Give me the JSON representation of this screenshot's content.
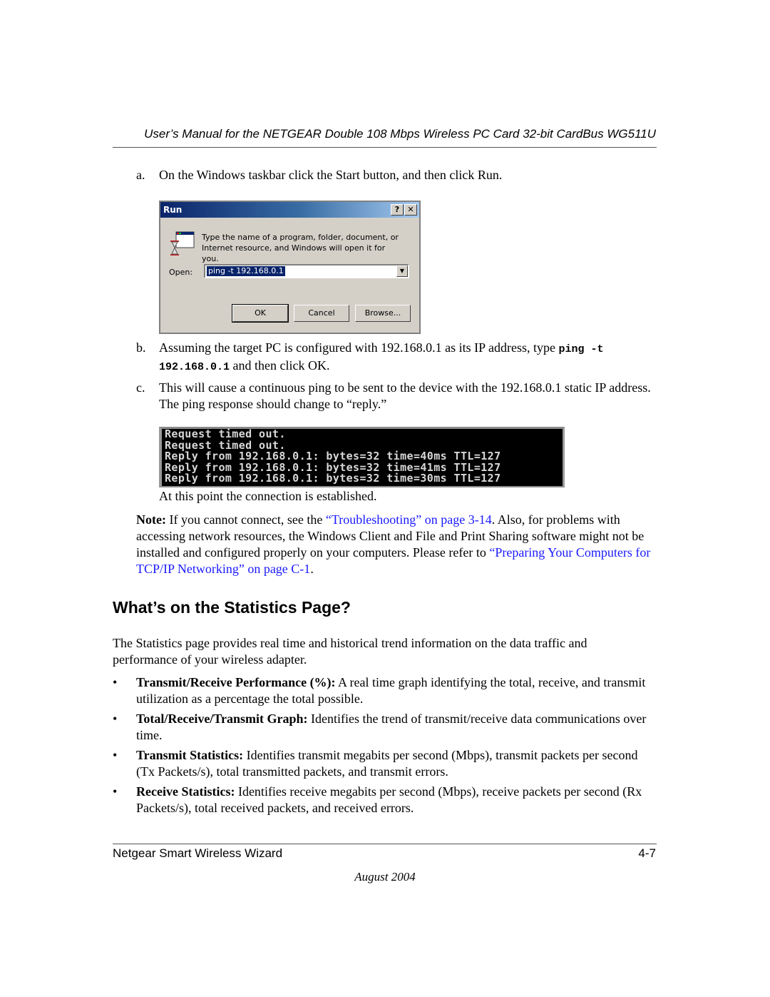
{
  "header": {
    "title": "User’s Manual for the NETGEAR Double 108 Mbps Wireless PC Card 32-bit CardBus WG511U"
  },
  "steps": [
    {
      "marker": "a.",
      "text": "On the Windows taskbar click the Start button, and then click Run."
    },
    {
      "marker": "b.",
      "text_before": "Assuming the target PC is configured with 192.168.0.1 as its IP address, type ",
      "code_1": "ping -t",
      "code_2": "192.168.0.1",
      "text_after": " and then click OK."
    },
    {
      "marker": "c.",
      "text": "This will cause a continuous ping to be sent to the device with the 192.168.0.1 static IP address. The ping response should change to “reply.”"
    }
  ],
  "run_dialog": {
    "title": "Run",
    "help_button": "?",
    "close_button": "✕",
    "icon": "run-program-icon",
    "description": "Type the name of a program, folder, document, or Internet resource, and Windows will open it for you.",
    "open_label": "Open:",
    "open_value": "ping -t 192.168.0.1",
    "dropdown_icon": "▼",
    "buttons": {
      "ok": "OK",
      "cancel": "Cancel",
      "browse": "Browse..."
    }
  },
  "console": {
    "lines": [
      "Request timed out.",
      "Request timed out.",
      "Reply from 192.168.0.1: bytes=32 time=40ms TTL=127",
      "Reply from 192.168.0.1: bytes=32 time=41ms TTL=127",
      "Reply from 192.168.0.1: bytes=32 time=30ms TTL=127"
    ]
  },
  "established_text": "At this point the connection is established.",
  "note": {
    "label": "Note:",
    "text_1": " If you cannot connect, see the ",
    "link_1": "“Troubleshooting” on page 3-14",
    "text_2": ". Also, for problems with accessing network resources, the Windows Client and File and Print Sharing software might not be installed and configured properly on your computers. Please refer to ",
    "link_2": "“Preparing Your Computers for TCP/IP Networking” on page C-1",
    "text_3": "."
  },
  "section": {
    "heading": "What’s on the Statistics Page?",
    "intro": "The Statistics page provides real time and historical trend information on the data traffic and performance of your wireless adapter.",
    "bullets": [
      {
        "term": "Transmit/Receive Performance (%):",
        "desc": " A real time graph identifying the total, receive, and transmit utilization as a percentage the total possible."
      },
      {
        "term": "Total/Receive/Transmit Graph:",
        "desc": " Identifies the trend of transmit/receive data communications over time."
      },
      {
        "term": "Transmit Statistics:",
        "desc": " Identifies transmit megabits per second (Mbps), transmit packets per second (Tx Packets/s), total transmitted packets, and transmit errors."
      },
      {
        "term": "Receive Statistics:",
        "desc": " Identifies receive megabits per second (Mbps), receive packets per second (Rx Packets/s), total received packets, and received errors."
      }
    ]
  },
  "footer": {
    "left": "Netgear Smart Wireless Wizard",
    "page": "4-7",
    "date": "August 2004"
  }
}
